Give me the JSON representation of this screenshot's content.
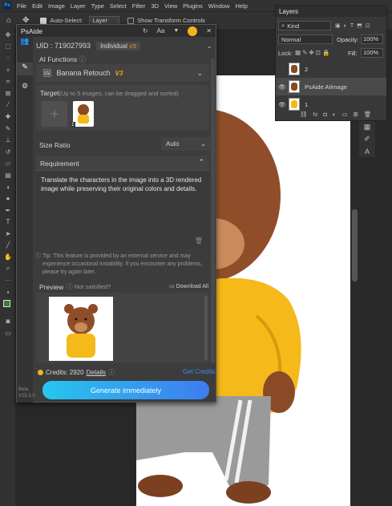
{
  "menubar": {
    "logo": "Ps",
    "items": [
      "File",
      "Edit",
      "Image",
      "Layer",
      "Type",
      "Select",
      "Filter",
      "3D",
      "View",
      "Plugins",
      "Window",
      "Help"
    ]
  },
  "options": {
    "auto_select_label": "Auto-Select:",
    "auto_select_value": "Layer",
    "show_transform": "Show Transform Controls"
  },
  "plugin": {
    "title": "PsAide",
    "title_icons": {
      "refresh": "↻",
      "text": "Aa",
      "pin": "📌",
      "close": "✕"
    },
    "uid": "UID : 719027993",
    "plan": "Individual",
    "plan_badge": "V3",
    "ai_functions_label": "AI Functions",
    "function_value": "Banana Retouch",
    "function_badge": "V3",
    "target_label": "Target",
    "target_hint": "(Up to 5 images, can be dragged and sorted)",
    "target_index": "1",
    "size_ratio_label": "Size Ratio",
    "size_ratio_value": "Auto",
    "requirement_label": "Requirement",
    "requirement_text": "Translate the characters in the image into a 3D rendered image while preserving their original colors and details.",
    "tip": "Tip: This feature is provided by an external service and may experience occasional instability. If you encounter any problems, please try again later.",
    "preview_label": "Preview",
    "not_satisfied": "Not satisfied?",
    "download_all": "Download All",
    "credits_label": "Credits: 2920",
    "details": "Details",
    "get_credits": "Get Credits",
    "generate": "Generate immediately",
    "beta": "Beta",
    "version": "V25.3.0"
  },
  "layers": {
    "title": "Layers",
    "kind": "Kind",
    "blend": "Normal",
    "opacity_label": "Opacity:",
    "opacity": "100%",
    "lock_label": "Lock:",
    "fill_label": "Fill:",
    "fill": "100%",
    "rows": [
      {
        "name": "2"
      },
      {
        "name": "PsAide AIimage"
      },
      {
        "name": "1"
      }
    ],
    "footer": "fx"
  },
  "colors": {
    "accent": "#3e8cf0",
    "gold": "#f2b51c",
    "hoodie": "#f5b91a",
    "fur": "#8a4a26"
  }
}
